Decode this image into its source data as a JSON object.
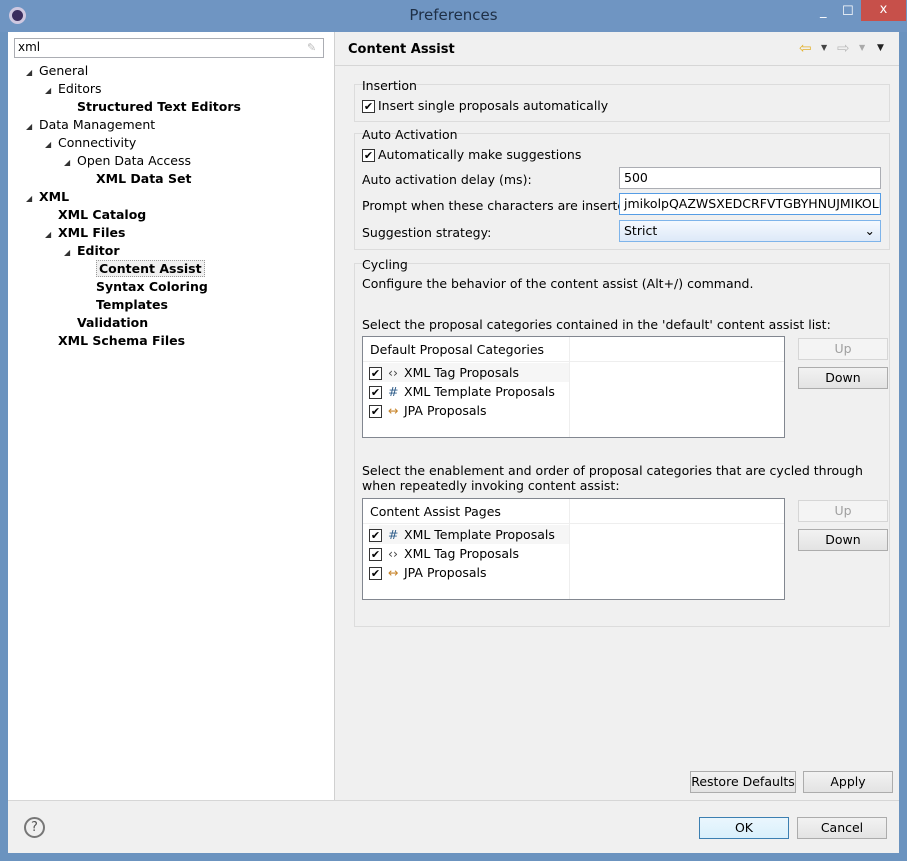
{
  "window": {
    "title": "Preferences",
    "minimize": "_",
    "maximize": "☐",
    "close": "x"
  },
  "search": {
    "value": "xml"
  },
  "tree": [
    {
      "label": "General",
      "level": 0,
      "arrow": true,
      "bold": false
    },
    {
      "label": "Editors",
      "level": 1,
      "arrow": true,
      "bold": false
    },
    {
      "label": "Structured Text Editors",
      "level": 2,
      "arrow": false,
      "bold": true
    },
    {
      "label": "Data Management",
      "level": 0,
      "arrow": true,
      "bold": false
    },
    {
      "label": "Connectivity",
      "level": 1,
      "arrow": true,
      "bold": false
    },
    {
      "label": "Open Data Access",
      "level": 2,
      "arrow": true,
      "bold": false
    },
    {
      "label": "XML Data Set",
      "level": 3,
      "arrow": false,
      "bold": true
    },
    {
      "label": "XML",
      "level": 0,
      "arrow": true,
      "bold": true
    },
    {
      "label": "XML Catalog",
      "level": 1,
      "arrow": false,
      "bold": true
    },
    {
      "label": "XML Files",
      "level": 1,
      "arrow": true,
      "bold": true
    },
    {
      "label": "Editor",
      "level": 2,
      "arrow": true,
      "bold": true
    },
    {
      "label": "Content Assist",
      "level": 3,
      "arrow": false,
      "bold": true,
      "selected": true
    },
    {
      "label": "Syntax Coloring",
      "level": 3,
      "arrow": false,
      "bold": true
    },
    {
      "label": "Templates",
      "level": 3,
      "arrow": false,
      "bold": true
    },
    {
      "label": "Validation",
      "level": 2,
      "arrow": false,
      "bold": true
    },
    {
      "label": "XML Schema Files",
      "level": 1,
      "arrow": false,
      "bold": true
    }
  ],
  "page": {
    "title": "Content Assist"
  },
  "insertion": {
    "label": "Insertion",
    "insert_single": "Insert single proposals automatically",
    "insert_single_checked": true
  },
  "auto": {
    "label": "Auto Activation",
    "make_suggestions": "Automatically make suggestions",
    "make_suggestions_checked": true,
    "delay_label": "Auto activation delay (ms):",
    "delay_value": "500",
    "prompt_label": "Prompt when these characters are inserted:",
    "prompt_value": "jmikolpQAZWSXEDCRFVTGBYHNUJMIKOLP",
    "strategy_label": "Suggestion strategy:",
    "strategy_value": "Strict"
  },
  "cycling": {
    "label": "Cycling",
    "desc": "Configure the behavior of the content assist (Alt+/) command.",
    "default_desc": "Select the proposal categories contained in the 'default' content assist list:",
    "default_header": "Default Proposal Categories",
    "default_items": [
      {
        "label": "XML Tag Proposals",
        "icon": "<>",
        "checked": true
      },
      {
        "label": "XML Template Proposals",
        "icon": "#",
        "checked": true
      },
      {
        "label": "JPA Proposals",
        "icon": "↔",
        "checked": true
      }
    ],
    "pages_desc": "Select the enablement and order of proposal categories that are cycled through when repeatedly invoking content assist:",
    "pages_header": "Content Assist Pages",
    "pages_items": [
      {
        "label": "XML Template Proposals",
        "icon": "#",
        "checked": true
      },
      {
        "label": "XML Tag Proposals",
        "icon": "<>",
        "checked": true
      },
      {
        "label": "JPA Proposals",
        "icon": "↔",
        "checked": true
      }
    ],
    "up": "Up",
    "down": "Down"
  },
  "buttons": {
    "restore": "Restore Defaults",
    "apply": "Apply",
    "ok": "OK",
    "cancel": "Cancel",
    "help": "?"
  }
}
